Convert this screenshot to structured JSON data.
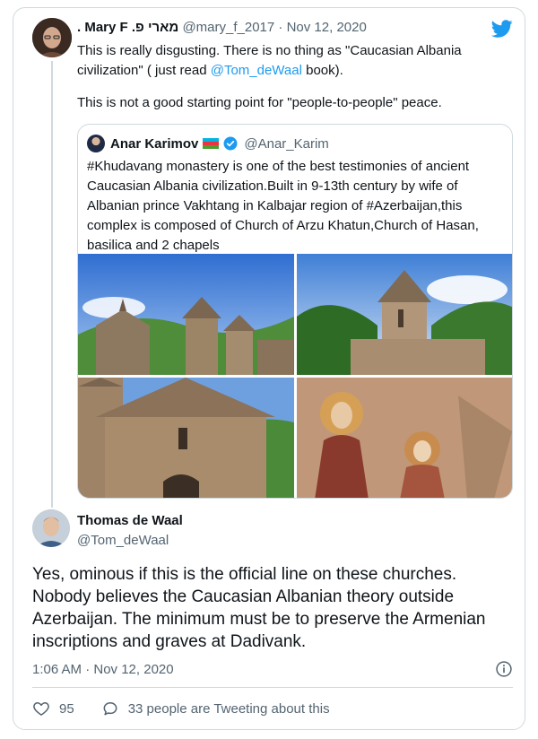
{
  "tweet": {
    "author_name": ". Mary F .מארי פ",
    "author_handle": "@mary_f_2017",
    "separator": " · ",
    "date": "Nov 12, 2020",
    "text_line1_a": "This is really disgusting. There is no thing as \"Caucasian Albania civilization\" ( just read ",
    "text_line1_link": "@Tom_deWaal",
    "text_line1_b": " book).",
    "text_line2": "This is not a good starting point for \"people-to-people\" peace."
  },
  "quoted": {
    "author_name": "Anar Karimov",
    "author_handle": "@Anar_Karim",
    "text": "#Khudavang monastery is one of the best testimonies of ancient Caucasian Albania civilization.Built in 9-13th century by wife of Albanian prince Vakhtang in Kalbajar region of #Azerbaijan,this complex is composed of Church of Arzu Khatun,Church of Hasan, basilica and 2 chapels",
    "flag_colors": [
      "#00b5e2",
      "#ef3340",
      "#509e2f"
    ]
  },
  "reply": {
    "author_name": "Thomas de Waal",
    "author_handle": "@Tom_deWaal",
    "text": "Yes, ominous if this is the official line on these churches. Nobody believes the Caucasian Albanian theory outside Azerbaijan. The minimum must be to preserve the Armenian inscriptions and graves at Dadivank.",
    "timestamp": "1:06 AM · Nov 12, 2020",
    "likes": "95",
    "retweeters_text": "33 people are Tweeting about this"
  },
  "colors": {
    "accent": "#1d9bf0",
    "text": "#0f1419",
    "muted": "#536471",
    "border": "#cfd9de"
  },
  "icons": {
    "brand": "twitter-bird-icon",
    "verified": "verified-badge-icon",
    "info": "info-icon",
    "like": "heart-icon",
    "comment": "speech-bubble-icon"
  }
}
